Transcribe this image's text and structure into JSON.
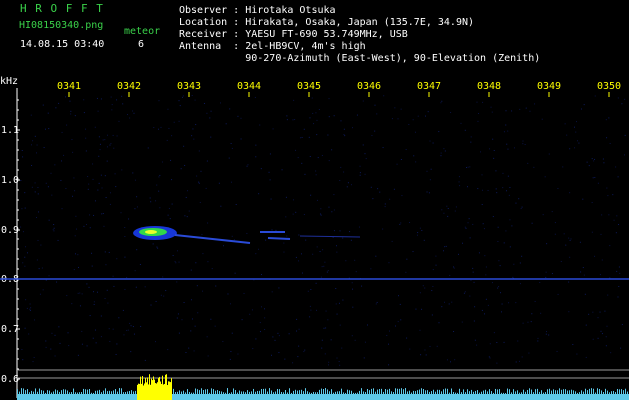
{
  "header": {
    "program": "H R O F F T",
    "filename": "HI08150340.png",
    "meteor_label": "meteor",
    "datetime": "14.08.15 03:40",
    "meteor_count": "6",
    "observer_line": "Observer : Hirotaka Otsuka",
    "location_line": "Location : Hirakata, Osaka, Japan (135.7E, 34.9N)",
    "receiver_line": "Receiver : YAESU FT-690 53.749MHz, USB",
    "antenna_line": "Antenna  : 2el-HB9CV, 4m's high",
    "antenna_line2": "           90-270-Azimuth (East-West), 90-Elevation (Zenith)"
  },
  "axis": {
    "unit": "kHz",
    "y_labels": [
      "1.1",
      "1.0",
      "0.9",
      "0.8",
      "0.7",
      "0.6"
    ],
    "x_labels": [
      "0341",
      "0342",
      "0343",
      "0344",
      "0345",
      "0346",
      "0347",
      "0348",
      "0349",
      "0350"
    ]
  },
  "colors": {
    "background": "#000000",
    "text_header": "#3ad14a",
    "text_info": "#ffffff",
    "time_labels": "#ffff00",
    "carrier_line": "#2a4bd8",
    "baseline": "#5ec9e8",
    "meteor_peak": "#ffff00"
  }
}
